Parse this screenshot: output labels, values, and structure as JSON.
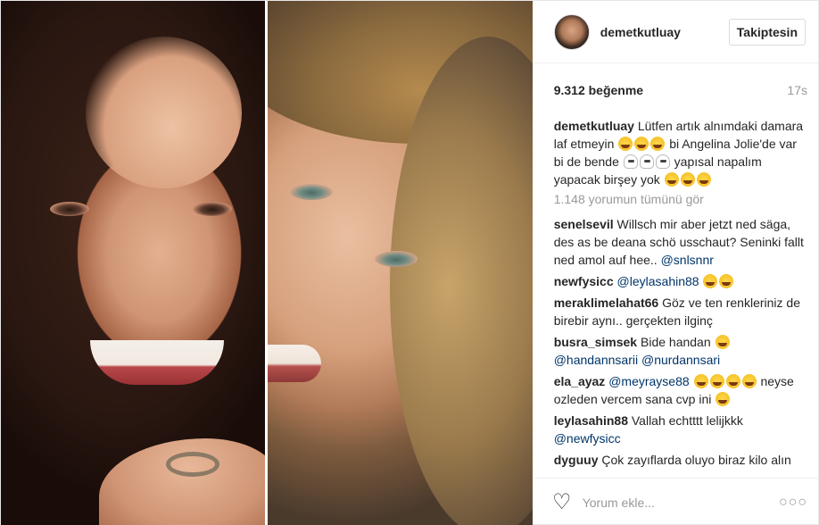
{
  "post": {
    "username": "demetkutluay",
    "follow_label": "Takiptesin",
    "likes": "9.312 beğenme",
    "time": "17s",
    "caption_user": "demetkutluay",
    "caption_part1": "Lütfen artık alnımdaki damara laf etmeyin",
    "caption_part2": "bi Angelina Jolie'de var bi de bende",
    "caption_part3": "yapısal napalım yapacak birşey yok",
    "view_all": "1.148 yorumun tümünü gör"
  },
  "comments": [
    {
      "user": "senelsevil",
      "text": "Willsch mir aber jetzt ned säga, des as be deana schö usschaut? Seninki fallt ned amol auf hee..",
      "mention": "@snlsnnr"
    },
    {
      "user": "newfysicc",
      "text": "",
      "mention": "@leylasahin88"
    },
    {
      "user": "meraklimelahat66",
      "text": "Göz ve ten renkleriniz de birebir aynı.. gerçekten ilginç",
      "mention": ""
    },
    {
      "user": "busra_simsek",
      "text": "Bide handan",
      "mention": "@handannsarii @nurdannsari"
    },
    {
      "user": "ela_ayaz",
      "text": "neyse ozleden vercem sana cvp ini",
      "mention": "@meyrayse88"
    },
    {
      "user": "leylasahin88",
      "text": "Vallah echtttt lelijkkk",
      "mention": "@newfysicc"
    },
    {
      "user": "dyguuy",
      "text": "Çok zayıflarda oluyo biraz kilo alın",
      "mention": ""
    }
  ],
  "footer": {
    "comment_placeholder": "Yorum ekle...",
    "more_label": "○○○",
    "heart_icon": "heart-outline-icon"
  }
}
